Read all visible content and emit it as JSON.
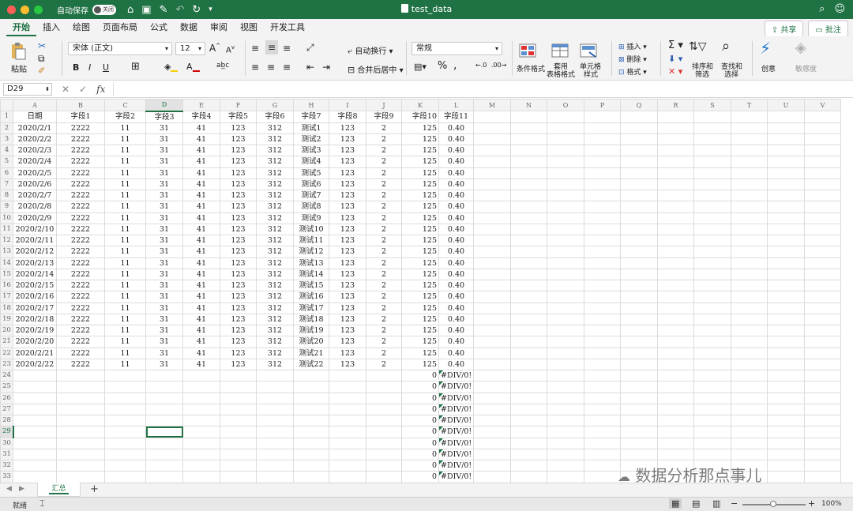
{
  "titlebar": {
    "autosave_label": "自动保存",
    "autosave_state": "关闭",
    "doc_title": "test_data"
  },
  "ribbon_tabs": [
    "开始",
    "插入",
    "绘图",
    "页面布局",
    "公式",
    "数据",
    "审阅",
    "视图",
    "开发工具"
  ],
  "share": {
    "share_label": "共享",
    "comment_label": "批注"
  },
  "ribbon": {
    "paste": "粘贴",
    "font_name": "宋体 (正文)",
    "font_size": "12",
    "wrap_text": "自动换行",
    "merge_center": "合并后居中",
    "number_format": "常规",
    "conditional_format": "条件格式",
    "table_format_line1": "套用",
    "table_format_line2": "表格格式",
    "cell_style_line1": "单元格",
    "cell_style_line2": "样式",
    "insert": "插入",
    "delete": "删除",
    "format": "格式",
    "sort_filter_line1": "排序和",
    "sort_filter_line2": "筛选",
    "find_select_line1": "查找和",
    "find_select_line2": "选择",
    "ideas": "创意",
    "sensitivity": "敏感度"
  },
  "formula_bar": {
    "name_box": "D29",
    "formula": ""
  },
  "columns": [
    "A",
    "B",
    "C",
    "D",
    "E",
    "F",
    "G",
    "H",
    "I",
    "J",
    "K",
    "L",
    "M",
    "N",
    "O",
    "P",
    "Q",
    "R",
    "S",
    "T",
    "U",
    "V"
  ],
  "header_row": [
    "日期",
    "字段1",
    "字段2",
    "字段3",
    "字段4",
    "字段5",
    "字段6",
    "字段7",
    "字段8",
    "字段9",
    "字段10",
    "字段11"
  ],
  "data_rows": [
    [
      "2020/2/1",
      "2222",
      "11",
      "31",
      "41",
      "123",
      "312",
      "测试1",
      "123",
      "2",
      "125",
      "0.40"
    ],
    [
      "2020/2/2",
      "2222",
      "11",
      "31",
      "41",
      "123",
      "312",
      "测试2",
      "123",
      "2",
      "125",
      "0.40"
    ],
    [
      "2020/2/3",
      "2222",
      "11",
      "31",
      "41",
      "123",
      "312",
      "测试3",
      "123",
      "2",
      "125",
      "0.40"
    ],
    [
      "2020/2/4",
      "2222",
      "11",
      "31",
      "41",
      "123",
      "312",
      "测试4",
      "123",
      "2",
      "125",
      "0.40"
    ],
    [
      "2020/2/5",
      "2222",
      "11",
      "31",
      "41",
      "123",
      "312",
      "测试5",
      "123",
      "2",
      "125",
      "0.40"
    ],
    [
      "2020/2/6",
      "2222",
      "11",
      "31",
      "41",
      "123",
      "312",
      "测试6",
      "123",
      "2",
      "125",
      "0.40"
    ],
    [
      "2020/2/7",
      "2222",
      "11",
      "31",
      "41",
      "123",
      "312",
      "测试7",
      "123",
      "2",
      "125",
      "0.40"
    ],
    [
      "2020/2/8",
      "2222",
      "11",
      "31",
      "41",
      "123",
      "312",
      "测试8",
      "123",
      "2",
      "125",
      "0.40"
    ],
    [
      "2020/2/9",
      "2222",
      "11",
      "31",
      "41",
      "123",
      "312",
      "测试9",
      "123",
      "2",
      "125",
      "0.40"
    ],
    [
      "2020/2/10",
      "2222",
      "11",
      "31",
      "41",
      "123",
      "312",
      "测试10",
      "123",
      "2",
      "125",
      "0.40"
    ],
    [
      "2020/2/11",
      "2222",
      "11",
      "31",
      "41",
      "123",
      "312",
      "测试11",
      "123",
      "2",
      "125",
      "0.40"
    ],
    [
      "2020/2/12",
      "2222",
      "11",
      "31",
      "41",
      "123",
      "312",
      "测试12",
      "123",
      "2",
      "125",
      "0.40"
    ],
    [
      "2020/2/13",
      "2222",
      "11",
      "31",
      "41",
      "123",
      "312",
      "测试13",
      "123",
      "2",
      "125",
      "0.40"
    ],
    [
      "2020/2/14",
      "2222",
      "11",
      "31",
      "41",
      "123",
      "312",
      "测试14",
      "123",
      "2",
      "125",
      "0.40"
    ],
    [
      "2020/2/15",
      "2222",
      "11",
      "31",
      "41",
      "123",
      "312",
      "测试15",
      "123",
      "2",
      "125",
      "0.40"
    ],
    [
      "2020/2/16",
      "2222",
      "11",
      "31",
      "41",
      "123",
      "312",
      "测试16",
      "123",
      "2",
      "125",
      "0.40"
    ],
    [
      "2020/2/17",
      "2222",
      "11",
      "31",
      "41",
      "123",
      "312",
      "测试17",
      "123",
      "2",
      "125",
      "0.40"
    ],
    [
      "2020/2/18",
      "2222",
      "11",
      "31",
      "41",
      "123",
      "312",
      "测试18",
      "123",
      "2",
      "125",
      "0.40"
    ],
    [
      "2020/2/19",
      "2222",
      "11",
      "31",
      "41",
      "123",
      "312",
      "测试19",
      "123",
      "2",
      "125",
      "0.40"
    ],
    [
      "2020/2/20",
      "2222",
      "11",
      "31",
      "41",
      "123",
      "312",
      "测试20",
      "123",
      "2",
      "125",
      "0.40"
    ],
    [
      "2020/2/21",
      "2222",
      "11",
      "31",
      "41",
      "123",
      "312",
      "测试21",
      "123",
      "2",
      "125",
      "0.40"
    ],
    [
      "2020/2/22",
      "2222",
      "11",
      "31",
      "41",
      "123",
      "312",
      "测试22",
      "123",
      "2",
      "125",
      "0.40"
    ]
  ],
  "empty_rows": {
    "k_value": "0",
    "l_value": "#DIV/0!",
    "count": 10
  },
  "selected_cell": {
    "column": "D",
    "row": 29
  },
  "sheets": {
    "active": "汇总",
    "add_label": "+"
  },
  "status": {
    "ready": "就绪",
    "zoom": "100%"
  },
  "watermark": "数据分析那点事儿",
  "colors": {
    "brand_green": "#1f7244",
    "error_triangle": "#1f7244"
  }
}
